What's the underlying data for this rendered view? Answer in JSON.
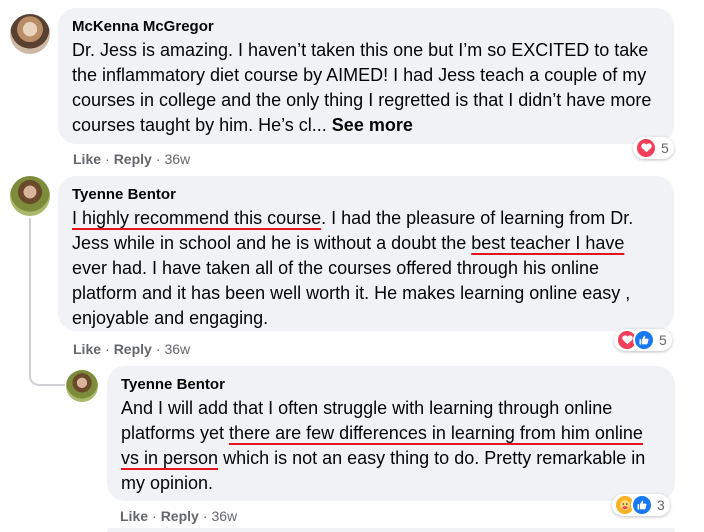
{
  "comments": [
    {
      "author": "McKenna McGregor",
      "text": "Dr. Jess is amazing. I haven’t taken this one but I’m so EXCITED to take the inflammatory diet course by AIMED! I had Jess teach a couple of my courses in college and the only thing I regretted is that I didn’t have more courses taught by him. He’s cl...",
      "see_more": "See more",
      "like": "Like",
      "reply": "Reply",
      "time": "36w",
      "reaction_count": "5",
      "reactions": [
        "love-icon"
      ]
    },
    {
      "author": "Tyenne Bentor",
      "segments": [
        {
          "text": "I highly recommend this course",
          "highlight": true
        },
        {
          "text": ". I had the pleasure of learning from Dr. Jess while in school and he is without a doubt the ",
          "highlight": false
        },
        {
          "text": "best teacher I have",
          "highlight": true
        },
        {
          "text": " ever had. I have taken all of the courses offered through his online platform and it has been well worth it. He makes learning online easy , enjoyable and engaging.",
          "highlight": false
        }
      ],
      "like": "Like",
      "reply": "Reply",
      "time": "36w",
      "reaction_count": "5",
      "reactions": [
        "love-icon",
        "like-icon"
      ]
    },
    {
      "author": "Tyenne Bentor",
      "segments": [
        {
          "text": "And I will add that I often struggle with learning through online platforms yet ",
          "highlight": false
        },
        {
          "text": "there are few differences in learning from him online vs in person",
          "highlight": true
        },
        {
          "text": " which is not an easy thing to do. Pretty remarkable in my opinion.",
          "highlight": false
        }
      ],
      "like": "Like",
      "reply": "Reply",
      "time": "36w",
      "reaction_count": "3",
      "reactions": [
        "care-icon",
        "like-icon"
      ]
    }
  ],
  "colors": {
    "bubble": "#f0f2f5",
    "meta_text": "#65676b",
    "highlight_underline": "#e4141d",
    "love": "#f33e58",
    "like": "#1877f2",
    "care": "#f7b125"
  }
}
